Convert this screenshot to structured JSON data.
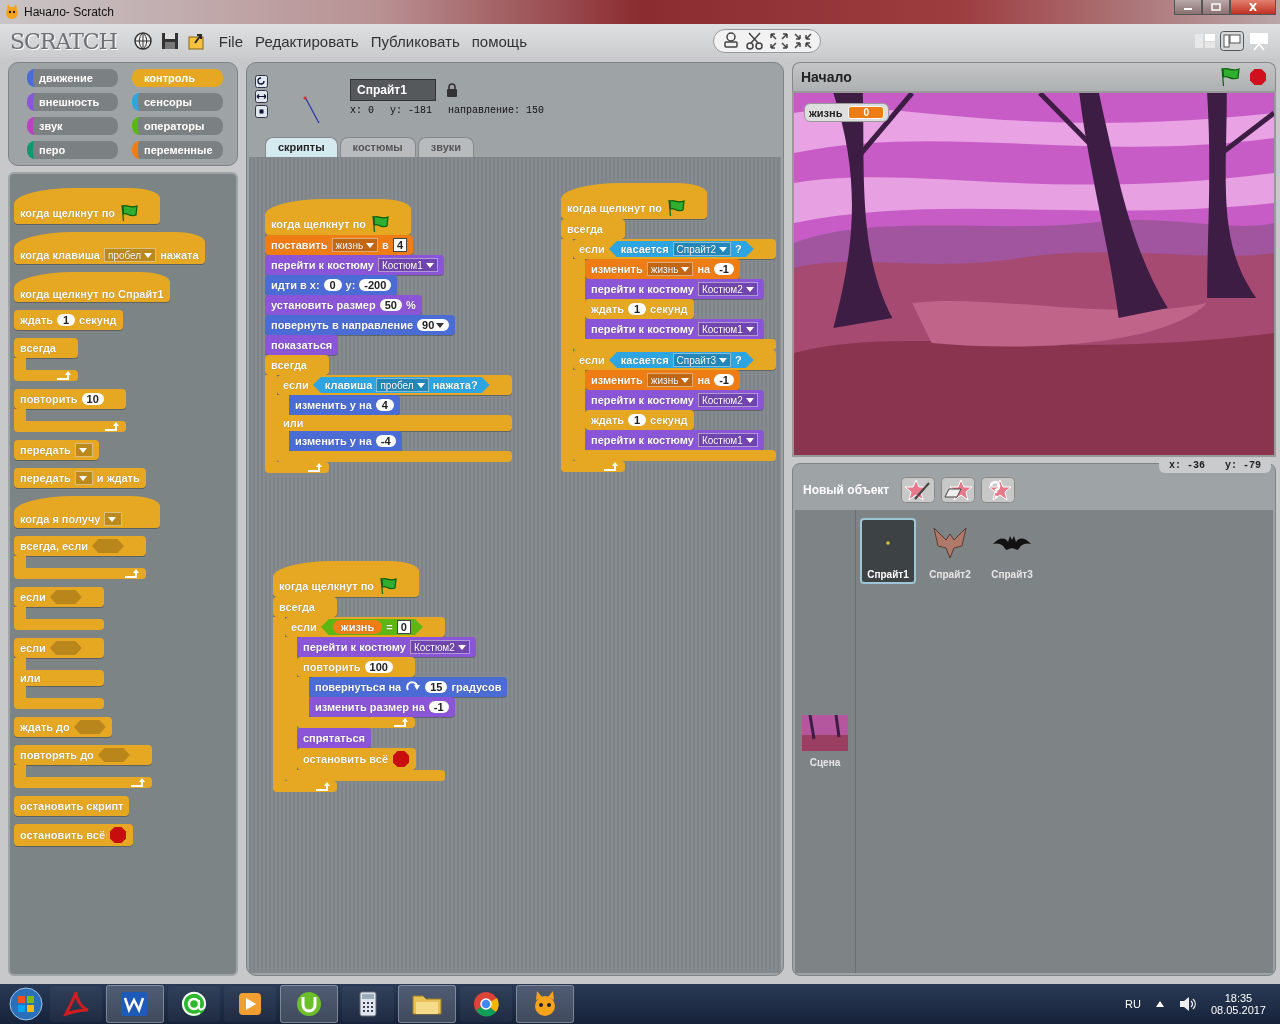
{
  "window": {
    "title": "Начало- Scratch"
  },
  "logo": "SCRATCH",
  "menu": [
    "File",
    "Редактировать",
    "Публиковать",
    "помощь"
  ],
  "categories": [
    {
      "label": "движение",
      "color": "#4a6cd4",
      "selected": false
    },
    {
      "label": "контроль",
      "color": "#e6a822",
      "selected": true
    },
    {
      "label": "внешность",
      "color": "#8a55d7",
      "selected": false
    },
    {
      "label": "сенсоры",
      "color": "#2ca5e2",
      "selected": false
    },
    {
      "label": "звук",
      "color": "#bb42c3",
      "selected": false
    },
    {
      "label": "операторы",
      "color": "#5cb712",
      "selected": false
    },
    {
      "label": "перо",
      "color": "#0e9a6c",
      "selected": false
    },
    {
      "label": "переменные",
      "color": "#ee7d16",
      "selected": false
    }
  ],
  "palette": [
    {
      "kind": "hat",
      "color": "#e6a822",
      "parts": [
        {
          "kind": "text",
          "text": "когда щелкнут по"
        },
        {
          "kind": "flag"
        }
      ]
    },
    {
      "kind": "hat",
      "color": "#e6a822",
      "parts": [
        {
          "kind": "text",
          "text": "когда клавиша"
        },
        {
          "kind": "menu",
          "text": "пробел"
        },
        {
          "kind": "text",
          "text": "нажата"
        }
      ]
    },
    {
      "kind": "hat",
      "color": "#e6a822",
      "parts": [
        {
          "kind": "text",
          "text": "когда щелкнут по  Спрайт1"
        }
      ]
    },
    {
      "kind": "stack",
      "color": "#e6a822",
      "parts": [
        {
          "kind": "text",
          "text": "ждать"
        },
        {
          "kind": "num",
          "text": "1"
        },
        {
          "kind": "text",
          "text": "секунд"
        }
      ]
    },
    {
      "kind": "c",
      "loop": true,
      "color": "#e6a822",
      "parts": [
        {
          "kind": "text",
          "text": "всегда"
        }
      ]
    },
    {
      "kind": "c",
      "loop": true,
      "color": "#e6a822",
      "parts": [
        {
          "kind": "text",
          "text": "повторить"
        },
        {
          "kind": "num",
          "text": "10"
        }
      ]
    },
    {
      "kind": "stack",
      "color": "#e6a822",
      "parts": [
        {
          "kind": "text",
          "text": "передать"
        },
        {
          "kind": "menu"
        }
      ]
    },
    {
      "kind": "stack",
      "color": "#e6a822",
      "parts": [
        {
          "kind": "text",
          "text": "передать"
        },
        {
          "kind": "menu"
        },
        {
          "kind": "text",
          "text": "и ждать"
        }
      ]
    },
    {
      "kind": "hat",
      "color": "#e6a822",
      "parts": [
        {
          "kind": "text",
          "text": "когда я получу"
        },
        {
          "kind": "menu"
        }
      ]
    },
    {
      "kind": "c",
      "loop": true,
      "color": "#e6a822",
      "parts": [
        {
          "kind": "text",
          "text": "всегда, если"
        },
        {
          "kind": "hex"
        }
      ]
    },
    {
      "kind": "c",
      "loop": false,
      "color": "#e6a822",
      "parts": [
        {
          "kind": "text",
          "text": "если"
        },
        {
          "kind": "hex"
        }
      ]
    },
    {
      "kind": "ifelse",
      "loop": false,
      "color": "#e6a822",
      "parts": [
        {
          "kind": "text",
          "text": "если"
        },
        {
          "kind": "hex"
        }
      ],
      "else_label": "или"
    },
    {
      "kind": "stack",
      "color": "#e6a822",
      "parts": [
        {
          "kind": "text",
          "text": "ждать до"
        },
        {
          "kind": "hex"
        }
      ]
    },
    {
      "kind": "c",
      "loop": true,
      "color": "#e6a822",
      "parts": [
        {
          "kind": "text",
          "text": "повторять до"
        },
        {
          "kind": "hex"
        }
      ]
    },
    {
      "kind": "stack",
      "color": "#e6a822",
      "parts": [
        {
          "kind": "text",
          "text": "остановить скрипт"
        }
      ]
    },
    {
      "kind": "stack",
      "color": "#e6a822",
      "parts": [
        {
          "kind": "text",
          "text": "остановить всё"
        },
        {
          "kind": "stop"
        }
      ]
    }
  ],
  "sprite": {
    "name": "Спрайт1",
    "x": "x: 0",
    "y": "y: -181",
    "direction": "направление: 150"
  },
  "tabs": [
    {
      "label": "скрипты",
      "selected": true
    },
    {
      "label": "костюмы",
      "selected": false
    },
    {
      "label": "звуки",
      "selected": false
    }
  ],
  "scripts": [
    {
      "blocks": [
        {
          "kind": "hat",
          "color": "#e6a822",
          "parts": [
            {
              "kind": "text",
              "text": "когда щелкнут по"
            },
            {
              "kind": "flag"
            }
          ]
        },
        {
          "kind": "stack",
          "color": "#ee7d16",
          "parts": [
            {
              "kind": "text",
              "text": "поставить"
            },
            {
              "kind": "menu",
              "text": "жизнь"
            },
            {
              "kind": "text",
              "text": "в"
            },
            {
              "kind": "box",
              "text": "4"
            }
          ]
        },
        {
          "kind": "stack",
          "color": "#8a55d7",
          "parts": [
            {
              "kind": "text",
              "text": "перейти к костюму"
            },
            {
              "kind": "menu",
              "text": "Костюм1"
            }
          ]
        },
        {
          "kind": "stack",
          "color": "#4a6cd4",
          "parts": [
            {
              "kind": "text",
              "text": "идти в x:"
            },
            {
              "kind": "num",
              "text": "0"
            },
            {
              "kind": "text",
              "text": "y:"
            },
            {
              "kind": "num",
              "text": "-200"
            }
          ]
        },
        {
          "kind": "stack",
          "color": "#8a55d7",
          "parts": [
            {
              "kind": "text",
              "text": "установить размер"
            },
            {
              "kind": "num",
              "text": "50"
            },
            {
              "kind": "text",
              "text": "%"
            }
          ]
        },
        {
          "kind": "stack",
          "color": "#4a6cd4",
          "parts": [
            {
              "kind": "text",
              "text": "повернуть в направление"
            },
            {
              "kind": "numenu",
              "text": "90"
            }
          ]
        },
        {
          "kind": "stack",
          "color": "#8a55d7",
          "parts": [
            {
              "kind": "text",
              "text": "показаться"
            }
          ]
        },
        {
          "kind": "c",
          "loop": true,
          "color": "#e6a822",
          "parts": [
            {
              "kind": "text",
              "text": "всегда"
            }
          ],
          "children": [
            {
              "kind": "ifelse",
              "loop": false,
              "color": "#e6a822",
              "parts": [
                {
                  "kind": "text",
                  "text": "если"
                },
                {
                  "kind": "bool",
                  "color": "#2ca5e2",
                  "parts": [
                    {
                      "kind": "text",
                      "text": "клавиша"
                    },
                    {
                      "kind": "menu",
                      "text": "пробел"
                    },
                    {
                      "kind": "text",
                      "text": "нажата?"
                    }
                  ]
                }
              ],
              "children": [
                {
                  "kind": "stack",
                  "color": "#4a6cd4",
                  "parts": [
                    {
                      "kind": "text",
                      "text": "изменить у на"
                    },
                    {
                      "kind": "num",
                      "text": "4"
                    }
                  ]
                }
              ],
              "else_label": "или",
              "else_children": [
                {
                  "kind": "stack",
                  "color": "#4a6cd4",
                  "parts": [
                    {
                      "kind": "text",
                      "text": "изменить у на"
                    },
                    {
                      "kind": "num",
                      "text": "-4"
                    }
                  ]
                }
              ]
            }
          ]
        }
      ]
    },
    {
      "blocks": [
        {
          "kind": "hat",
          "color": "#e6a822",
          "parts": [
            {
              "kind": "text",
              "text": "когда щелкнут по"
            },
            {
              "kind": "flag"
            }
          ]
        },
        {
          "kind": "c",
          "loop": true,
          "color": "#e6a822",
          "parts": [
            {
              "kind": "text",
              "text": "всегда"
            }
          ],
          "children": [
            {
              "kind": "c",
              "loop": false,
              "color": "#e6a822",
              "parts": [
                {
                  "kind": "text",
                  "text": "если"
                },
                {
                  "kind": "bool",
                  "color": "#2ca5e2",
                  "parts": [
                    {
                      "kind": "text",
                      "text": "касается"
                    },
                    {
                      "kind": "menu",
                      "text": "Спрайт2"
                    },
                    {
                      "kind": "text",
                      "text": "?"
                    }
                  ]
                }
              ],
              "children": [
                {
                  "kind": "stack",
                  "color": "#ee7d16",
                  "parts": [
                    {
                      "kind": "text",
                      "text": "изменить"
                    },
                    {
                      "kind": "menu",
                      "text": "жизнь"
                    },
                    {
                      "kind": "text",
                      "text": "на"
                    },
                    {
                      "kind": "num",
                      "text": "-1"
                    }
                  ]
                },
                {
                  "kind": "stack",
                  "color": "#8a55d7",
                  "parts": [
                    {
                      "kind": "text",
                      "text": "перейти к костюму"
                    },
                    {
                      "kind": "menu",
                      "text": "Костюм2"
                    }
                  ]
                },
                {
                  "kind": "stack",
                  "color": "#e6a822",
                  "parts": [
                    {
                      "kind": "text",
                      "text": "ждать"
                    },
                    {
                      "kind": "num",
                      "text": "1"
                    },
                    {
                      "kind": "text",
                      "text": "секунд"
                    }
                  ]
                },
                {
                  "kind": "stack",
                  "color": "#8a55d7",
                  "parts": [
                    {
                      "kind": "text",
                      "text": "перейти к костюму"
                    },
                    {
                      "kind": "menu",
                      "text": "Костюм1"
                    }
                  ]
                }
              ]
            },
            {
              "kind": "c",
              "loop": false,
              "color": "#e6a822",
              "parts": [
                {
                  "kind": "text",
                  "text": "если"
                },
                {
                  "kind": "bool",
                  "color": "#2ca5e2",
                  "parts": [
                    {
                      "kind": "text",
                      "text": "касается"
                    },
                    {
                      "kind": "menu",
                      "text": "Спрайт3"
                    },
                    {
                      "kind": "text",
                      "text": "?"
                    }
                  ]
                }
              ],
              "children": [
                {
                  "kind": "stack",
                  "color": "#ee7d16",
                  "parts": [
                    {
                      "kind": "text",
                      "text": "изменить"
                    },
                    {
                      "kind": "menu",
                      "text": "жизнь"
                    },
                    {
                      "kind": "text",
                      "text": "на"
                    },
                    {
                      "kind": "num",
                      "text": "-1"
                    }
                  ]
                },
                {
                  "kind": "stack",
                  "color": "#8a55d7",
                  "parts": [
                    {
                      "kind": "text",
                      "text": "перейти к костюму"
                    },
                    {
                      "kind": "menu",
                      "text": "Костюм2"
                    }
                  ]
                },
                {
                  "kind": "stack",
                  "color": "#e6a822",
                  "parts": [
                    {
                      "kind": "text",
                      "text": "ждать"
                    },
                    {
                      "kind": "num",
                      "text": "1"
                    },
                    {
                      "kind": "text",
                      "text": "секунд"
                    }
                  ]
                },
                {
                  "kind": "stack",
                  "color": "#8a55d7",
                  "parts": [
                    {
                      "kind": "text",
                      "text": "перейти к костюму"
                    },
                    {
                      "kind": "menu",
                      "text": "Костюм1"
                    }
                  ]
                }
              ]
            }
          ]
        }
      ]
    },
    {
      "blocks": [
        {
          "kind": "hat",
          "color": "#e6a822",
          "parts": [
            {
              "kind": "text",
              "text": "когда щелкнут по"
            },
            {
              "kind": "flag"
            }
          ]
        },
        {
          "kind": "c",
          "loop": true,
          "color": "#e6a822",
          "parts": [
            {
              "kind": "text",
              "text": "всегда"
            }
          ],
          "children": [
            {
              "kind": "c",
              "loop": false,
              "color": "#e6a822",
              "parts": [
                {
                  "kind": "text",
                  "text": "если"
                },
                {
                  "kind": "bool",
                  "color": "#5cb712",
                  "parts": [
                    {
                      "kind": "var",
                      "color": "#ee7d16",
                      "text": "жизнь"
                    },
                    {
                      "kind": "text",
                      "text": "="
                    },
                    {
                      "kind": "box",
                      "text": "0"
                    }
                  ]
                }
              ],
              "children": [
                {
                  "kind": "stack",
                  "color": "#8a55d7",
                  "parts": [
                    {
                      "kind": "text",
                      "text": "перейти к костюму"
                    },
                    {
                      "kind": "menu",
                      "text": "Костюм2"
                    }
                  ]
                },
                {
                  "kind": "c",
                  "loop": true,
                  "color": "#e6a822",
                  "parts": [
                    {
                      "kind": "text",
                      "text": "повторить"
                    },
                    {
                      "kind": "num",
                      "text": "100"
                    }
                  ],
                  "children": [
                    {
                      "kind": "stack",
                      "color": "#4a6cd4",
                      "parts": [
                        {
                          "kind": "text",
                          "text": "повернуться на"
                        },
                        {
                          "kind": "rotate"
                        },
                        {
                          "kind": "num",
                          "text": "15"
                        },
                        {
                          "kind": "text",
                          "text": "градусов"
                        }
                      ]
                    },
                    {
                      "kind": "stack",
                      "color": "#8a55d7",
                      "parts": [
                        {
                          "kind": "text",
                          "text": "изменить размер на"
                        },
                        {
                          "kind": "num",
                          "text": "-1"
                        }
                      ]
                    }
                  ]
                },
                {
                  "kind": "stack",
                  "color": "#8a55d7",
                  "parts": [
                    {
                      "kind": "text",
                      "text": "спрятаться"
                    }
                  ]
                },
                {
                  "kind": "stack",
                  "color": "#e6a822",
                  "parts": [
                    {
                      "kind": "text",
                      "text": "остановить всё"
                    },
                    {
                      "kind": "stop"
                    }
                  ]
                }
              ]
            }
          ]
        }
      ]
    }
  ],
  "stage": {
    "title": "Начало",
    "monitor": {
      "label": "жизнь",
      "value": "0"
    }
  },
  "mouse": {
    "x": "x: -36",
    "y": "y: -79"
  },
  "new_sprite": {
    "label": "Новый объект"
  },
  "sprites": [
    {
      "name": "Спрайт1",
      "selected": true
    },
    {
      "name": "Спрайт2",
      "selected": false
    },
    {
      "name": "Спрайт3",
      "selected": false
    }
  ],
  "stage_item": {
    "name": "Сцена"
  },
  "taskbar": {
    "language": "RU",
    "time": "18:35",
    "date": "08.05.2017"
  }
}
